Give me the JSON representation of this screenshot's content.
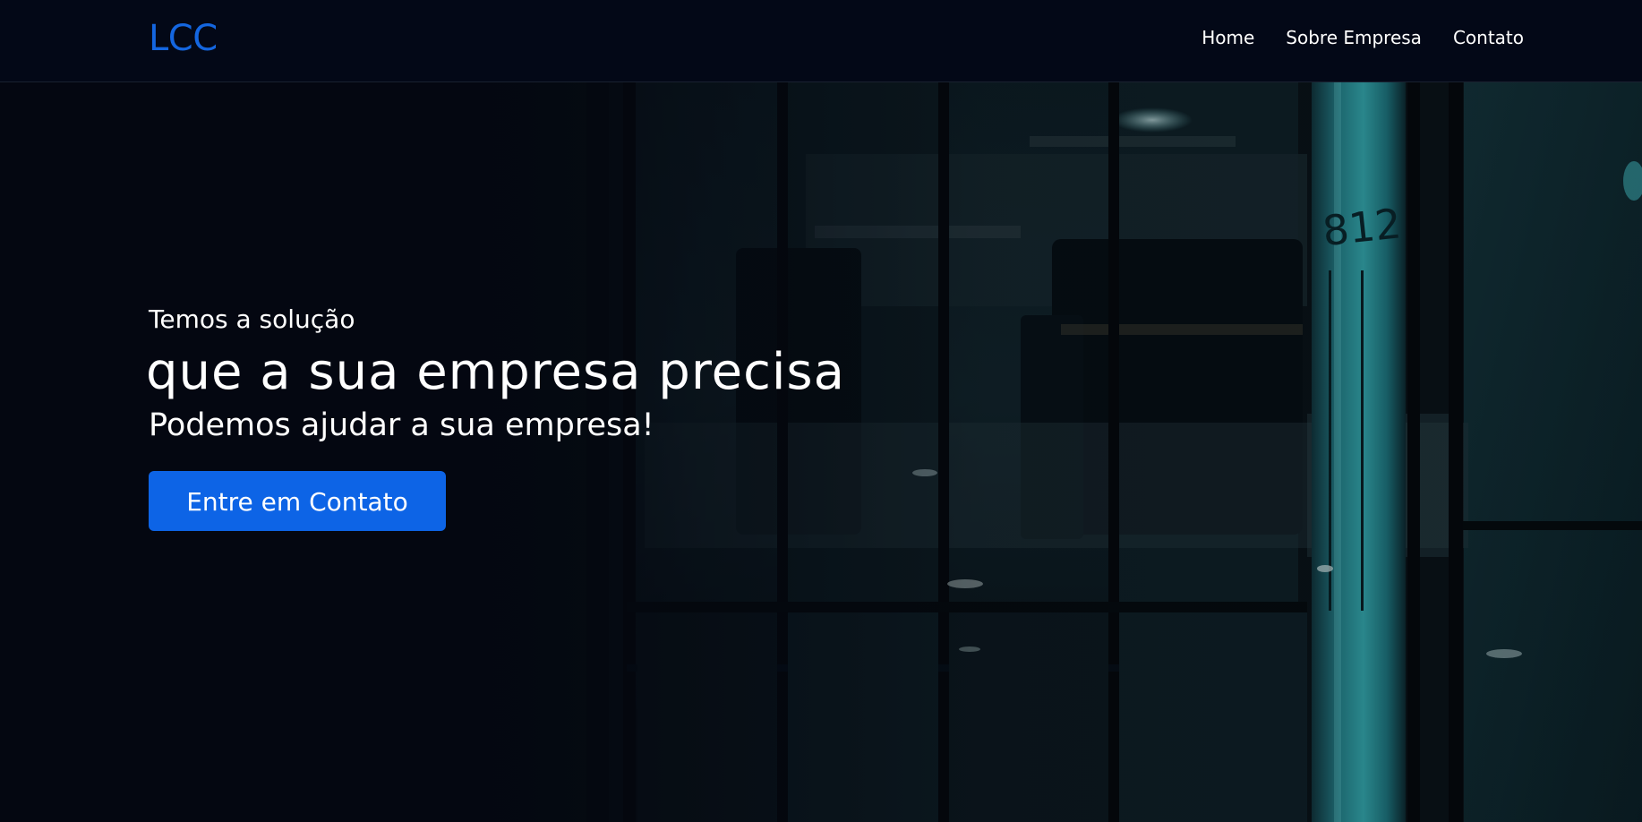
{
  "header": {
    "logo": "LCC",
    "nav": [
      {
        "label": "Home"
      },
      {
        "label": "Sobre Empresa"
      },
      {
        "label": "Contato"
      }
    ]
  },
  "hero": {
    "kicker": "Temos a solução",
    "title": "que a sua empresa precisa",
    "subtitle": "Podemos ajudar a sua empresa!",
    "cta_label": "Entre em Contato",
    "background_image": "dark-office-building-night"
  },
  "colors": {
    "page_background": "#030712",
    "navbar_background": "#030817",
    "brand_blue": "#1466e0",
    "button_blue": "#0d64e6",
    "accent_cyan": "#2fb3b8"
  }
}
